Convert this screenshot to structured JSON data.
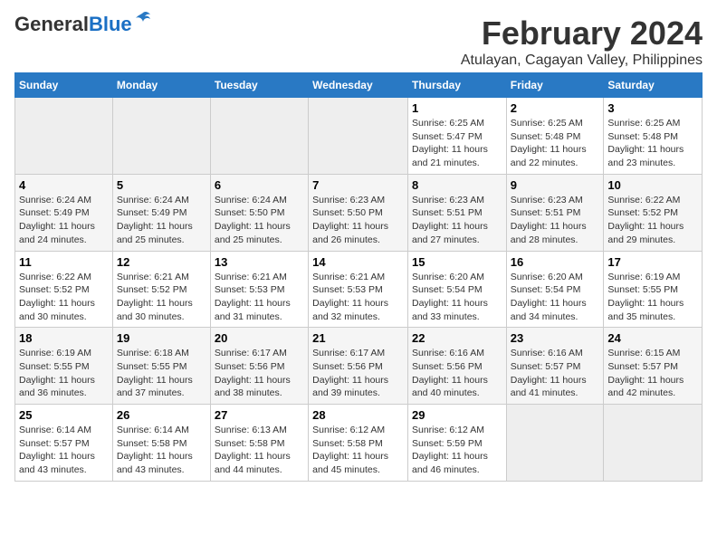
{
  "logo": {
    "general": "General",
    "blue": "Blue"
  },
  "title": "February 2024",
  "subtitle": "Atulayan, Cagayan Valley, Philippines",
  "days_of_week": [
    "Sunday",
    "Monday",
    "Tuesday",
    "Wednesday",
    "Thursday",
    "Friday",
    "Saturday"
  ],
  "weeks": [
    [
      {
        "day": "",
        "info": ""
      },
      {
        "day": "",
        "info": ""
      },
      {
        "day": "",
        "info": ""
      },
      {
        "day": "",
        "info": ""
      },
      {
        "day": "1",
        "info": "Sunrise: 6:25 AM\nSunset: 5:47 PM\nDaylight: 11 hours and 21 minutes."
      },
      {
        "day": "2",
        "info": "Sunrise: 6:25 AM\nSunset: 5:48 PM\nDaylight: 11 hours and 22 minutes."
      },
      {
        "day": "3",
        "info": "Sunrise: 6:25 AM\nSunset: 5:48 PM\nDaylight: 11 hours and 23 minutes."
      }
    ],
    [
      {
        "day": "4",
        "info": "Sunrise: 6:24 AM\nSunset: 5:49 PM\nDaylight: 11 hours and 24 minutes."
      },
      {
        "day": "5",
        "info": "Sunrise: 6:24 AM\nSunset: 5:49 PM\nDaylight: 11 hours and 25 minutes."
      },
      {
        "day": "6",
        "info": "Sunrise: 6:24 AM\nSunset: 5:50 PM\nDaylight: 11 hours and 25 minutes."
      },
      {
        "day": "7",
        "info": "Sunrise: 6:23 AM\nSunset: 5:50 PM\nDaylight: 11 hours and 26 minutes."
      },
      {
        "day": "8",
        "info": "Sunrise: 6:23 AM\nSunset: 5:51 PM\nDaylight: 11 hours and 27 minutes."
      },
      {
        "day": "9",
        "info": "Sunrise: 6:23 AM\nSunset: 5:51 PM\nDaylight: 11 hours and 28 minutes."
      },
      {
        "day": "10",
        "info": "Sunrise: 6:22 AM\nSunset: 5:52 PM\nDaylight: 11 hours and 29 minutes."
      }
    ],
    [
      {
        "day": "11",
        "info": "Sunrise: 6:22 AM\nSunset: 5:52 PM\nDaylight: 11 hours and 30 minutes."
      },
      {
        "day": "12",
        "info": "Sunrise: 6:21 AM\nSunset: 5:52 PM\nDaylight: 11 hours and 30 minutes."
      },
      {
        "day": "13",
        "info": "Sunrise: 6:21 AM\nSunset: 5:53 PM\nDaylight: 11 hours and 31 minutes."
      },
      {
        "day": "14",
        "info": "Sunrise: 6:21 AM\nSunset: 5:53 PM\nDaylight: 11 hours and 32 minutes."
      },
      {
        "day": "15",
        "info": "Sunrise: 6:20 AM\nSunset: 5:54 PM\nDaylight: 11 hours and 33 minutes."
      },
      {
        "day": "16",
        "info": "Sunrise: 6:20 AM\nSunset: 5:54 PM\nDaylight: 11 hours and 34 minutes."
      },
      {
        "day": "17",
        "info": "Sunrise: 6:19 AM\nSunset: 5:55 PM\nDaylight: 11 hours and 35 minutes."
      }
    ],
    [
      {
        "day": "18",
        "info": "Sunrise: 6:19 AM\nSunset: 5:55 PM\nDaylight: 11 hours and 36 minutes."
      },
      {
        "day": "19",
        "info": "Sunrise: 6:18 AM\nSunset: 5:55 PM\nDaylight: 11 hours and 37 minutes."
      },
      {
        "day": "20",
        "info": "Sunrise: 6:17 AM\nSunset: 5:56 PM\nDaylight: 11 hours and 38 minutes."
      },
      {
        "day": "21",
        "info": "Sunrise: 6:17 AM\nSunset: 5:56 PM\nDaylight: 11 hours and 39 minutes."
      },
      {
        "day": "22",
        "info": "Sunrise: 6:16 AM\nSunset: 5:56 PM\nDaylight: 11 hours and 40 minutes."
      },
      {
        "day": "23",
        "info": "Sunrise: 6:16 AM\nSunset: 5:57 PM\nDaylight: 11 hours and 41 minutes."
      },
      {
        "day": "24",
        "info": "Sunrise: 6:15 AM\nSunset: 5:57 PM\nDaylight: 11 hours and 42 minutes."
      }
    ],
    [
      {
        "day": "25",
        "info": "Sunrise: 6:14 AM\nSunset: 5:57 PM\nDaylight: 11 hours and 43 minutes."
      },
      {
        "day": "26",
        "info": "Sunrise: 6:14 AM\nSunset: 5:58 PM\nDaylight: 11 hours and 43 minutes."
      },
      {
        "day": "27",
        "info": "Sunrise: 6:13 AM\nSunset: 5:58 PM\nDaylight: 11 hours and 44 minutes."
      },
      {
        "day": "28",
        "info": "Sunrise: 6:12 AM\nSunset: 5:58 PM\nDaylight: 11 hours and 45 minutes."
      },
      {
        "day": "29",
        "info": "Sunrise: 6:12 AM\nSunset: 5:59 PM\nDaylight: 11 hours and 46 minutes."
      },
      {
        "day": "",
        "info": ""
      },
      {
        "day": "",
        "info": ""
      }
    ]
  ]
}
